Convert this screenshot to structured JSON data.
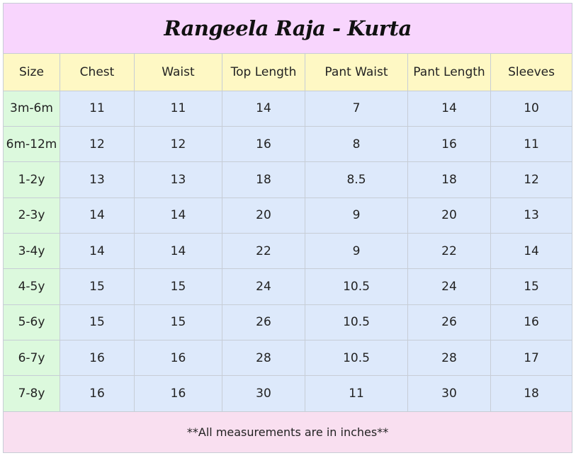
{
  "title": "Rangeela Raja - Kurta",
  "columns": [
    "Size",
    "Chest",
    "Waist",
    "Top Length",
    "Pant Waist",
    "Pant Length",
    "Sleeves"
  ],
  "rows": [
    [
      "3m-6m",
      "11",
      "11",
      "14",
      "7",
      "14",
      "10"
    ],
    [
      "6m-12m",
      "12",
      "12",
      "16",
      "8",
      "16",
      "11"
    ],
    [
      "1-2y",
      "13",
      "13",
      "18",
      "8.5",
      "18",
      "12"
    ],
    [
      "2-3y",
      "14",
      "14",
      "20",
      "9",
      "20",
      "13"
    ],
    [
      "3-4y",
      "14",
      "14",
      "22",
      "9",
      "22",
      "14"
    ],
    [
      "4-5y",
      "15",
      "15",
      "24",
      "10.5",
      "24",
      "15"
    ],
    [
      "5-6y",
      "15",
      "15",
      "26",
      "10.5",
      "26",
      "16"
    ],
    [
      "6-7y",
      "16",
      "16",
      "28",
      "10.5",
      "28",
      "17"
    ],
    [
      "7-8y",
      "16",
      "16",
      "30",
      "11",
      "30",
      "18"
    ]
  ],
  "footer": "**All measurements are in inches**",
  "colors": {
    "title_bg": "#f8d5fd",
    "header_bg": "#fef8c4",
    "size_col_bg": "#dcf9dd",
    "value_bg": "#dde9fb",
    "footer_bg": "#f9dff0",
    "grid": "#c7cdd6"
  }
}
